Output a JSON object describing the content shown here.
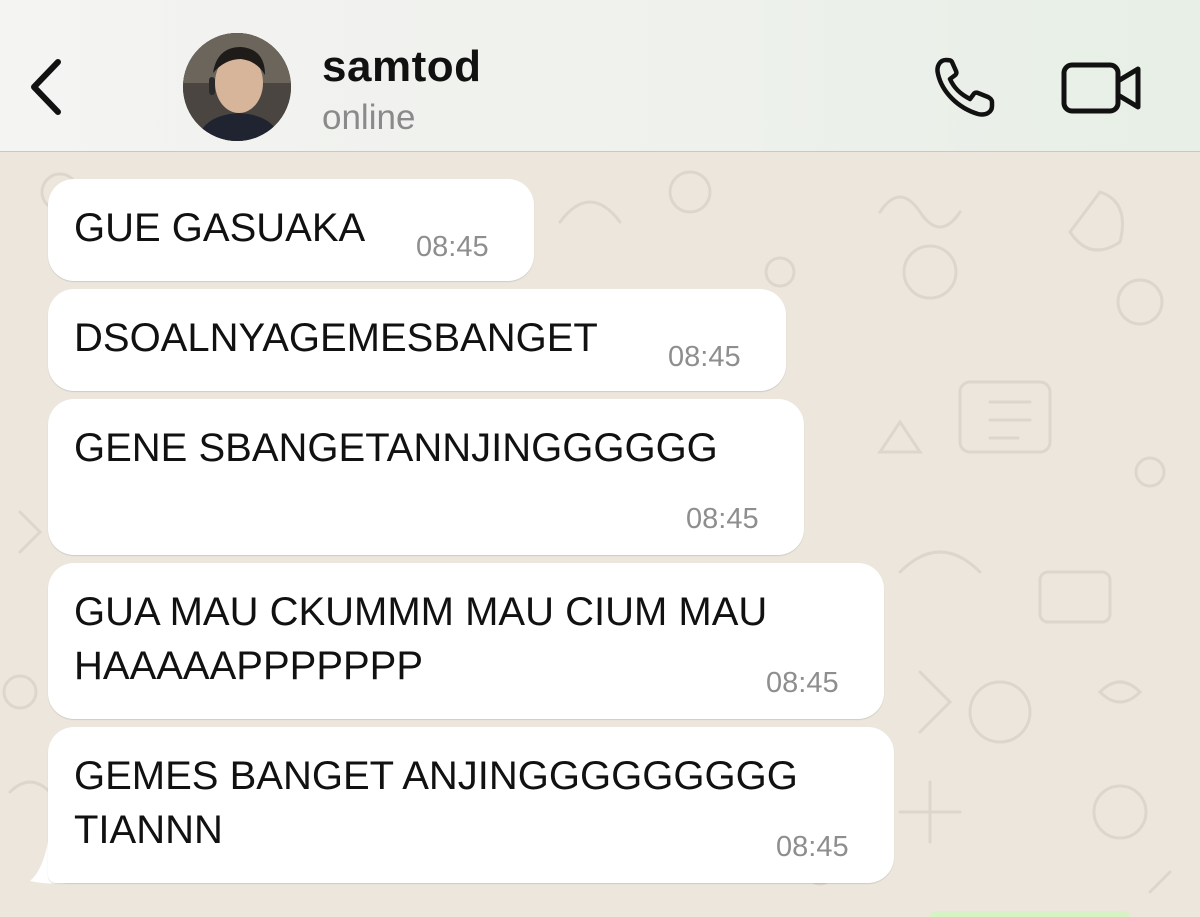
{
  "header": {
    "contact_name": "samtod",
    "status": "online",
    "icons": {
      "back": "chevron-left-icon",
      "call": "phone-icon",
      "video": "video-camera-icon"
    }
  },
  "messages": [
    {
      "text": "GUE GASUAKA",
      "time": "08:45"
    },
    {
      "text": "DSOALNYAGEMESBANGET",
      "time": "08:45"
    },
    {
      "text": "GENE SBANGETANNJINGGGGGG",
      "time": "08:45"
    },
    {
      "text": "GUA MAU CKUMMM MAU CIUM MAU\nHAAAAAPPPPPPP",
      "time": "08:45"
    },
    {
      "text": "GEMES BANGET ANJINGGGGGGGGG\nTIANNN",
      "time": "08:45"
    }
  ],
  "colors": {
    "chat_background": "#ece6dd",
    "bubble": "#ffffff",
    "timestamp": "#8e8e8e",
    "status": "#8a8a8a"
  }
}
